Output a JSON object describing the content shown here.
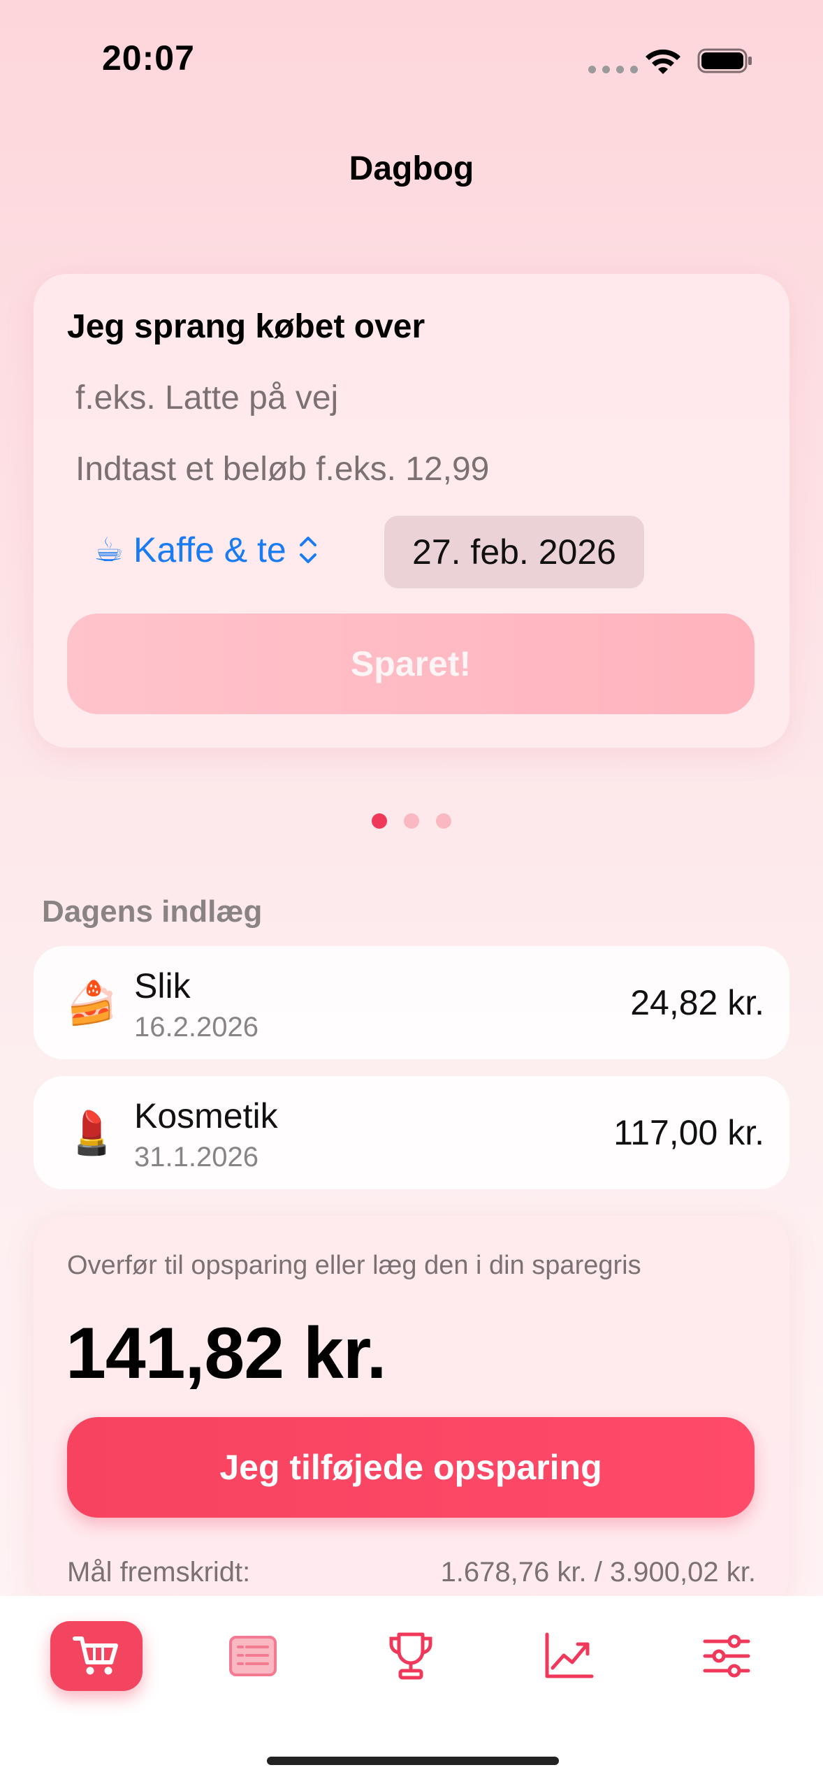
{
  "status_bar": {
    "time": "20:07",
    "wifi_icon": "wifi-icon",
    "battery_icon": "battery-icon"
  },
  "nav": {
    "title": "Dagbog"
  },
  "entry_form": {
    "title": "Jeg sprang købet over",
    "note_placeholder": "f.eks. Latte på vej",
    "amount_placeholder": "Indtast et beløb f.eks. 12,99",
    "category_emoji": "☕",
    "category_label": "Kaffe & te",
    "date_value": "27. feb. 2026",
    "submit_label": "Sparet!"
  },
  "pager": {
    "pages": 3,
    "active_index": 0,
    "active_color": "#f0395a",
    "inactive_color": "#f9b8c2"
  },
  "today_entries": {
    "header": "Dagens indlæg",
    "items": [
      {
        "emoji": "🍰",
        "name": "Slik",
        "date": "16.2.2026",
        "amount": "24,82 kr."
      },
      {
        "emoji": "💄",
        "name": "Kosmetik",
        "date": "31.1.2026",
        "amount": "117,00 kr."
      }
    ]
  },
  "summary": {
    "label": "Overfør til opsparing eller læg den i din sparegris",
    "total": "141,82 kr.",
    "button_label": "Jeg tilføjede opsparing",
    "progress_label": "Mål fremskridt:",
    "progress_value": "1.678,76 kr. / 3.900,02 kr."
  },
  "tab_bar": {
    "tabs": [
      {
        "icon": "cart-icon",
        "active": true
      },
      {
        "icon": "list-icon",
        "active": false
      },
      {
        "icon": "trophy-icon",
        "active": false
      },
      {
        "icon": "chart-icon",
        "active": false
      },
      {
        "icon": "sliders-icon",
        "active": false
      }
    ],
    "accent_color": "#f34560"
  }
}
